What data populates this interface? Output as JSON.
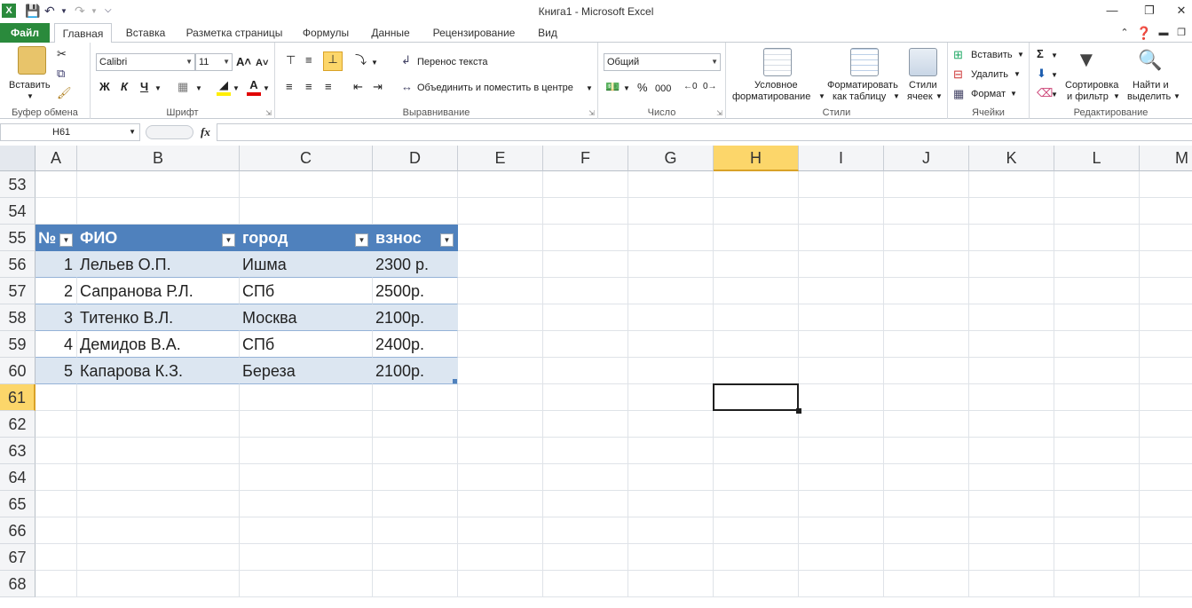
{
  "window": {
    "title": "Книга1  -  Microsoft Excel"
  },
  "tabs": [
    "Файл",
    "Главная",
    "Вставка",
    "Разметка страницы",
    "Формулы",
    "Данные",
    "Рецензирование",
    "Вид"
  ],
  "ribbon": {
    "clipboard": {
      "paste": "Вставить",
      "label": "Буфер обмена"
    },
    "font": {
      "name": "Calibri",
      "size": "11",
      "bold": "Ж",
      "italic": "К",
      "underline": "Ч",
      "label": "Шрифт"
    },
    "alignment": {
      "wrap": "Перенос текста",
      "merge": "Объединить и поместить в центре",
      "label": "Выравнивание"
    },
    "number": {
      "format": "Общий",
      "percent": "%",
      "thousands": "000",
      "label": "Число"
    },
    "styles": {
      "conditional_1": "Условное",
      "conditional_2": "форматирование",
      "table_1": "Форматировать",
      "table_2": "как таблицу",
      "cell_1": "Стили",
      "cell_2": "ячеек",
      "label": "Стили"
    },
    "cells": {
      "insert": "Вставить",
      "delete": "Удалить",
      "format": "Формат",
      "label": "Ячейки"
    },
    "editing": {
      "sort_1": "Сортировка",
      "sort_2": "и фильтр",
      "find_1": "Найти и",
      "find_2": "выделить",
      "label": "Редактирование"
    }
  },
  "formula_bar": {
    "name_box": "H61",
    "fx": "fx",
    "value": ""
  },
  "columns": [
    "A",
    "B",
    "C",
    "D",
    "E",
    "F",
    "G",
    "H",
    "I",
    "J",
    "K",
    "L",
    "M"
  ],
  "selected_column": "H",
  "rows": [
    "53",
    "54",
    "55",
    "56",
    "57",
    "58",
    "59",
    "60",
    "61",
    "62",
    "63",
    "64",
    "65",
    "66",
    "67",
    "68"
  ],
  "selected_row": "61",
  "table": {
    "headers": [
      "№",
      "ФИО",
      "город",
      "взнос"
    ],
    "rows": [
      [
        "1",
        "Лельев О.П.",
        "Ишма",
        "2300 р."
      ],
      [
        "2",
        "Сапранова Р.Л.",
        "СПб",
        "2500р."
      ],
      [
        "3",
        "Титенко В.Л.",
        "Москва",
        "2100р."
      ],
      [
        "4",
        "Демидов В.А.",
        "СПб",
        "2400р."
      ],
      [
        "5",
        "Капарова К.З.",
        "Береза",
        "2100р."
      ]
    ]
  },
  "colors": {
    "excel_green": "#2a8a3c",
    "table_header": "#4f81bd",
    "table_band": "#dce6f1",
    "selection_header": "#fcd66a"
  }
}
